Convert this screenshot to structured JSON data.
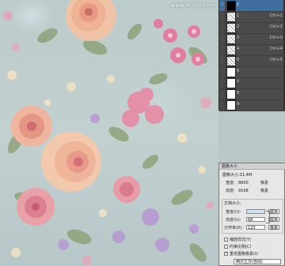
{
  "canvas": {
    "watermark": "www.huitu.com"
  },
  "layers": {
    "rows": [
      {
        "index": "3",
        "thumb": "black",
        "name": "0",
        "shortcut": "",
        "selected": true
      },
      {
        "index": "",
        "thumb": "pattern",
        "name": "1",
        "shortcut": "Ctrl+1"
      },
      {
        "index": "",
        "thumb": "pattern",
        "name": "2",
        "shortcut": "Ctrl+2"
      },
      {
        "index": "",
        "thumb": "pattern",
        "name": "3",
        "shortcut": "Ctrl+3"
      },
      {
        "index": "",
        "thumb": "pattern",
        "name": "4",
        "shortcut": "Ctrl+4"
      },
      {
        "index": "",
        "thumb": "pattern",
        "name": "5",
        "shortcut": "Ctrl+5"
      },
      {
        "index": "",
        "thumb": "white",
        "name": "6",
        "shortcut": ""
      },
      {
        "index": "",
        "thumb": "white",
        "name": "7",
        "shortcut": ""
      },
      {
        "index": "",
        "thumb": "white",
        "name": "8",
        "shortcut": ""
      },
      {
        "index": "",
        "thumb": "white",
        "name": "9",
        "shortcut": ""
      }
    ]
  },
  "dialog": {
    "title": "图像大小",
    "image_size_label": "图像大小:31.4M",
    "width_label": "宽度:",
    "width_value": "8600",
    "width_unit": "像素",
    "height_label": "高度:",
    "height_value": "9168",
    "height_unit": "像素",
    "doc_size_label": "文档大小:",
    "doc_width_label": "宽度(D):",
    "doc_width_unit": "厘米",
    "doc_height_label": "高度(G):",
    "doc_height_value": "68",
    "doc_height_unit": "厘米",
    "resolution_label": "分辨率(R):",
    "resolution_value": "120",
    "resolution_unit": "像素",
    "scale_styles": "缩放样式(Y)",
    "constrain": "约束比例(C)",
    "resample": "重定图像像素(I):",
    "resample_method": "两次立方(自动)"
  },
  "colors": {
    "panel_bg": "#4b4b4b",
    "selected_row": "#3f6fa0",
    "dialog_bg": "#e6e6e6"
  }
}
